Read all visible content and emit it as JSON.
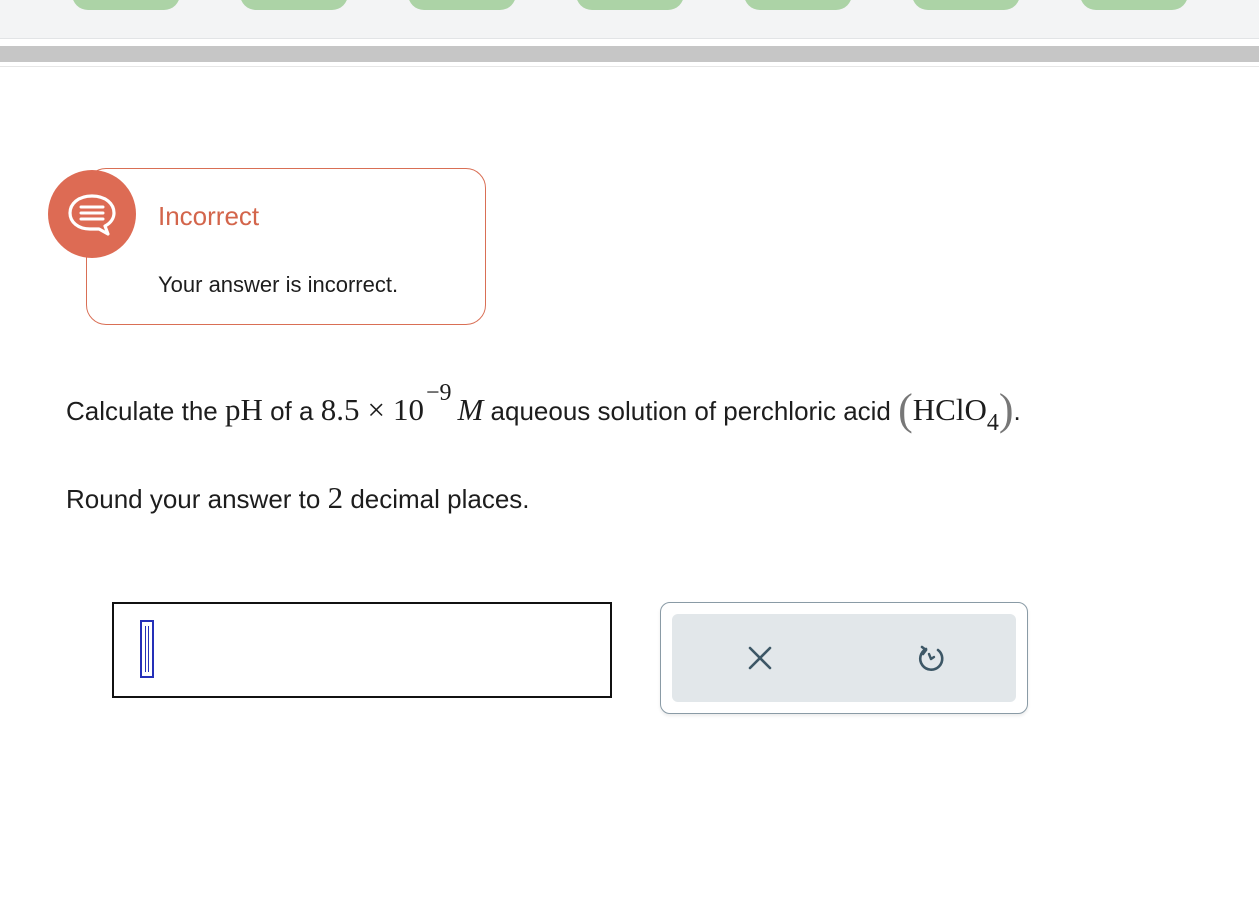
{
  "header": {
    "progress_segments": 7,
    "segment_color": "#acd3a6"
  },
  "feedback": {
    "title": "Incorrect",
    "message": "Your answer is incorrect.",
    "icon": "feedback-speech-bubble-icon",
    "accent_color": "#dd6b54"
  },
  "question": {
    "prefix": "Calculate the ",
    "ph": "pH",
    "of_a": " of a ",
    "coefficient": "8.5",
    "times": "×",
    "base": "10",
    "exponent": "−9",
    "unit": "M",
    "middle": " aqueous solution of perchloric acid ",
    "open_paren": "(",
    "formula": "HClO",
    "formula_subscript": "4",
    "close_paren": ")",
    "end": "."
  },
  "instruction": {
    "prefix": "Round your answer to ",
    "places": "2",
    "suffix": " decimal places."
  },
  "answer": {
    "value": ""
  },
  "actions": {
    "clear_icon": "close-icon",
    "undo_icon": "undo-icon"
  }
}
